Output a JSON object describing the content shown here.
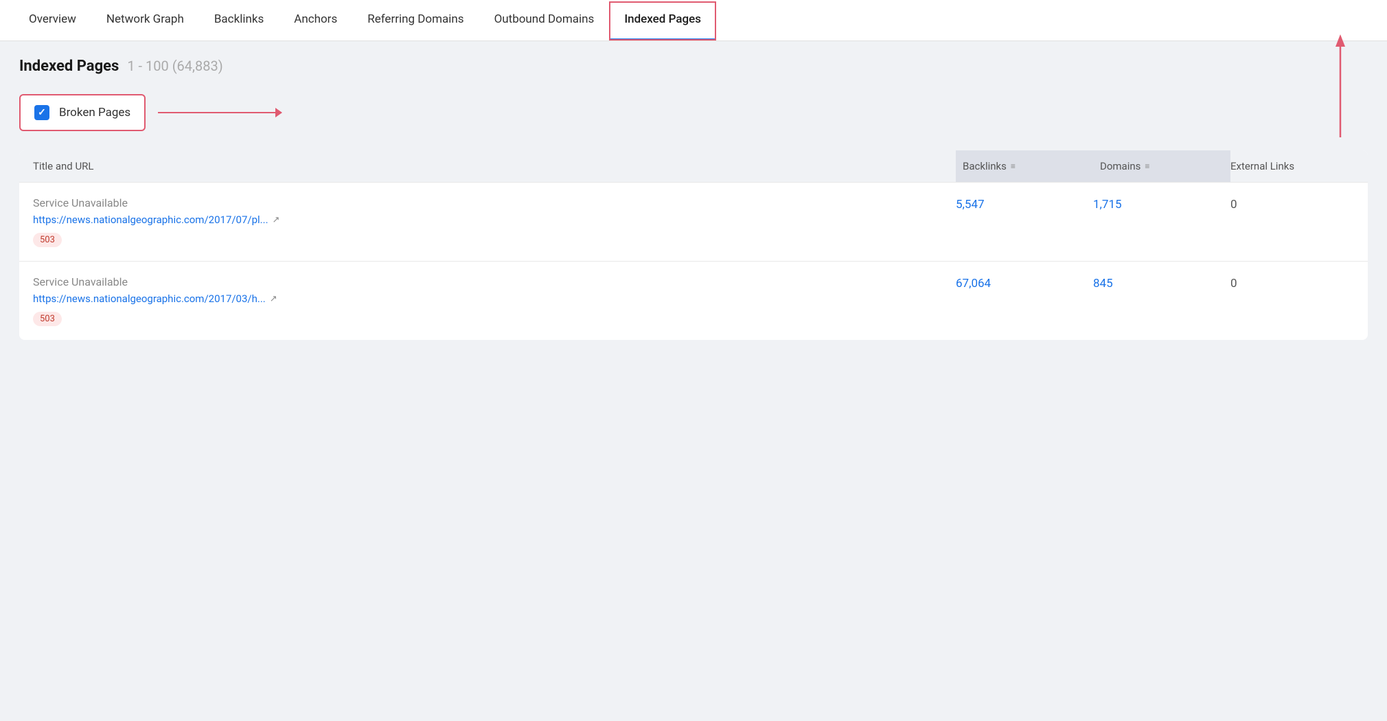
{
  "nav": {
    "items": [
      {
        "id": "overview",
        "label": "Overview",
        "active": false
      },
      {
        "id": "network-graph",
        "label": "Network Graph",
        "active": false
      },
      {
        "id": "backlinks",
        "label": "Backlinks",
        "active": false
      },
      {
        "id": "anchors",
        "label": "Anchors",
        "active": false
      },
      {
        "id": "referring-domains",
        "label": "Referring Domains",
        "active": false
      },
      {
        "id": "outbound-domains",
        "label": "Outbound Domains",
        "active": false
      },
      {
        "id": "indexed-pages",
        "label": "Indexed Pages",
        "active": true
      }
    ]
  },
  "page": {
    "title": "Indexed Pages",
    "range": "1 - 100 (64,883)"
  },
  "filter": {
    "broken_pages_label": "Broken Pages",
    "checked": true
  },
  "table": {
    "columns": [
      {
        "id": "title-url",
        "label": "Title and URL",
        "sorted": false
      },
      {
        "id": "backlinks",
        "label": "Backlinks",
        "sorted": true
      },
      {
        "id": "domains",
        "label": "Domains",
        "sorted": true
      },
      {
        "id": "external-links",
        "label": "External Links",
        "sorted": false
      }
    ],
    "rows": [
      {
        "title": "Service Unavailable",
        "url": "https://news.nationalgeographic.com/2017/07/pl...",
        "status": "503",
        "backlinks": "5,547",
        "domains": "1,715",
        "external_links": "0"
      },
      {
        "title": "Service Unavailable",
        "url": "https://news.nationalgeographic.com/2017/03/h...",
        "status": "503",
        "backlinks": "67,064",
        "domains": "845",
        "external_links": "0"
      }
    ]
  },
  "icons": {
    "external_link": "↗",
    "sort": "≡",
    "check": "✓"
  }
}
